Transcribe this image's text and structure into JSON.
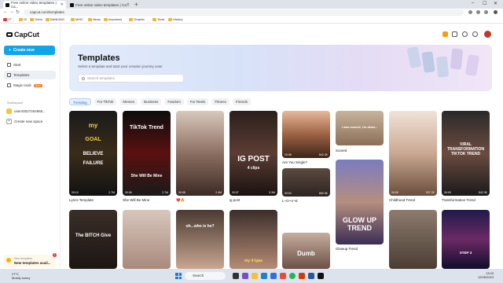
{
  "browser": {
    "tabs": [
      {
        "title": "Free online video templates | Ca..."
      },
      {
        "title": "Free online video templates | Ca..."
      }
    ],
    "url": "capcut.com/templates",
    "bookmarks": [
      "YT",
      "GI",
      "Ortrm",
      "BANKING",
      "MISC",
      "News",
      "Important",
      "Graphic",
      "Tools",
      "History"
    ]
  },
  "sidebar": {
    "logo": "CapCut",
    "create_label": "Create new",
    "items": [
      {
        "label": "Start"
      },
      {
        "label": "Templates"
      },
      {
        "label": "Magic tools",
        "badge": "New"
      }
    ],
    "workspace_label": "Workspace",
    "workspace_name": "user40027264965...",
    "new_space": "Create new space",
    "notification": {
      "sub": "New templates",
      "title": "New templates avail...",
      "count": "1"
    }
  },
  "hero": {
    "title": "Templates",
    "subtitle": "Select a template and start your creation journey now!",
    "search_placeholder": "Search templates"
  },
  "filters": [
    "Trending",
    "For TikTok",
    "Memes",
    "Business",
    "Fandom",
    "For Reels",
    "Fitness",
    "Friends"
  ],
  "cards": {
    "c1": {
      "caption": "Lyrics Template",
      "dur": "00:10",
      "likes": "2.7M",
      "text": "BELIEVE",
      "text2": "FAILURE"
    },
    "c2": {
      "caption": "She Will Be Mine",
      "dur": "00:06",
      "likes": "2.7M",
      "text": "TikTok Trend",
      "text2": "She Will Be Mine"
    },
    "c3": {
      "caption": "❤️🔥",
      "dur": "00:08",
      "likes": "2.4M"
    },
    "c4": {
      "caption": "ig post",
      "dur": "00:07",
      "likes": "5.3M",
      "text": "IG POST",
      "text2": "4 clips"
    },
    "c5": {
      "caption": "Are You Single?",
      "dur": "00:08",
      "likes": "842.3K"
    },
    "c6": {
      "caption": "Scared",
      "text": "I was scared, I'm dead..."
    },
    "c7": {
      "caption": "Childhood Trend",
      "dur": "00:09",
      "likes": "937.2K"
    },
    "c8": {
      "caption": "Transformation Trend",
      "dur": "00:09",
      "likes": "842.3K",
      "text": "VIRAL TRANSFORMATION TIKTOK TREND"
    },
    "c9": {
      "caption": "L~O~V~E",
      "dur": "00:04",
      "likes": "860.9K"
    },
    "c10": {
      "caption": "Glowup Trend",
      "text": "GLOW UP TREND"
    },
    "c11": {
      "text": "The BITCH Give"
    },
    "c12": {},
    "c13": {
      "text": "oh...who is he?"
    },
    "c14": {
      "text": "my 4 type"
    },
    "c15": {
      "text": "Dumb"
    },
    "c16": {},
    "c17": {
      "text": "STEP 3"
    }
  },
  "taskbar": {
    "weather_temp": "27°C",
    "weather_desc": "Mostly sunny",
    "search": "Search",
    "time": "13:03",
    "date": "12/06/2023"
  }
}
